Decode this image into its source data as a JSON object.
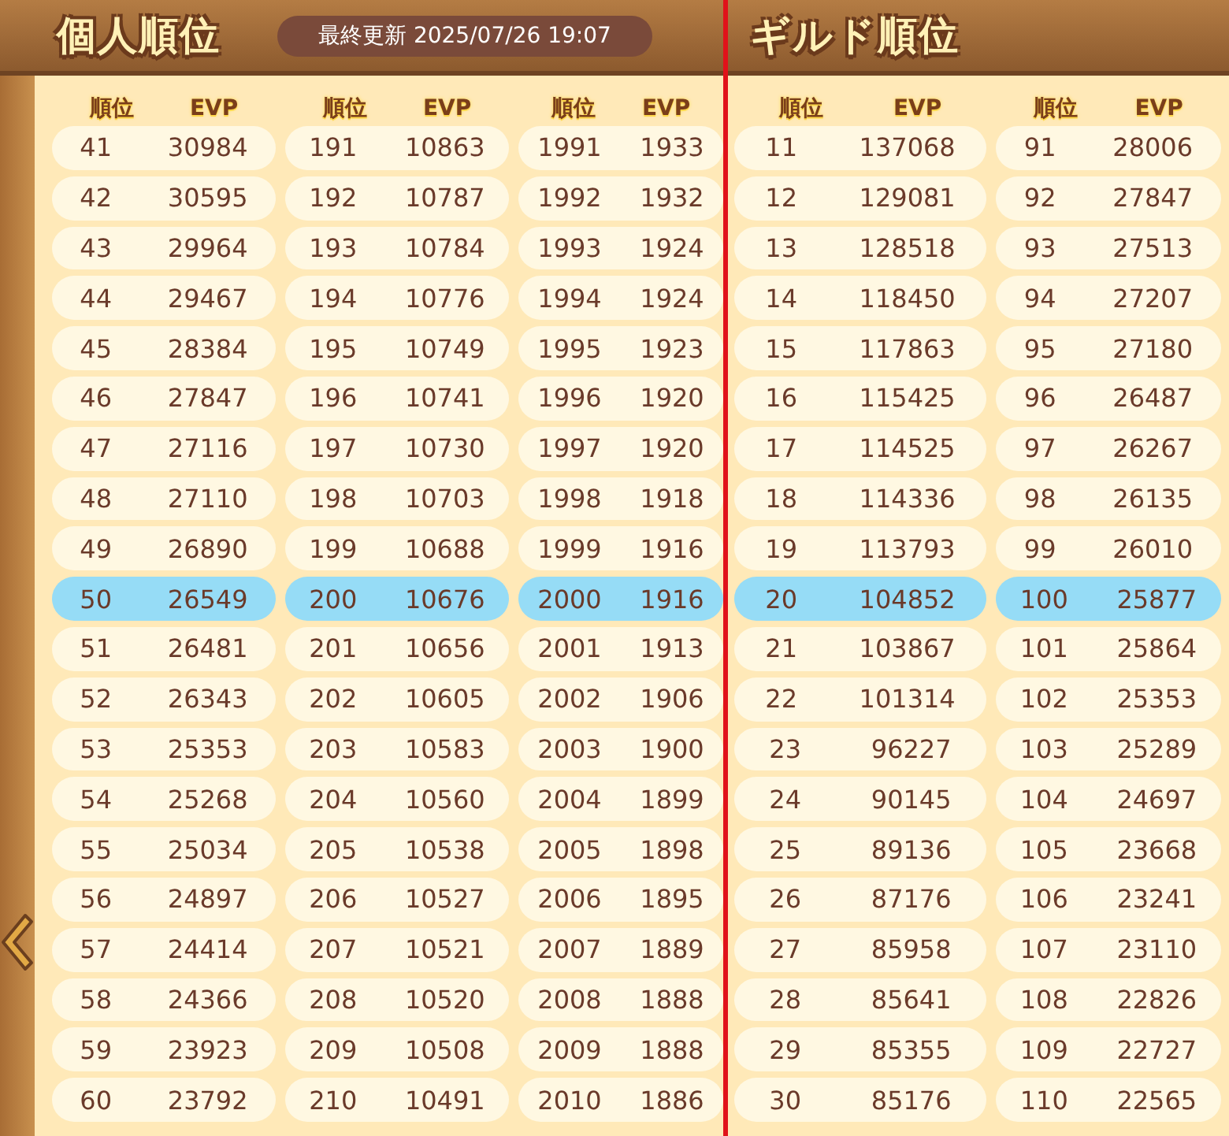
{
  "panels": [
    {
      "title": "個人順位",
      "updated": "最終更新 2025/07/26 19:07",
      "columns": [
        {
          "headers": [
            "順位",
            "EVP"
          ],
          "rows": [
            {
              "rank": "41",
              "evp": "30984",
              "selected": false
            },
            {
              "rank": "42",
              "evp": "30595",
              "selected": false
            },
            {
              "rank": "43",
              "evp": "29964",
              "selected": false
            },
            {
              "rank": "44",
              "evp": "29467",
              "selected": false
            },
            {
              "rank": "45",
              "evp": "28384",
              "selected": false
            },
            {
              "rank": "46",
              "evp": "27847",
              "selected": false
            },
            {
              "rank": "47",
              "evp": "27116",
              "selected": false
            },
            {
              "rank": "48",
              "evp": "27110",
              "selected": false
            },
            {
              "rank": "49",
              "evp": "26890",
              "selected": false
            },
            {
              "rank": "50",
              "evp": "26549",
              "selected": true
            },
            {
              "rank": "51",
              "evp": "26481",
              "selected": false
            },
            {
              "rank": "52",
              "evp": "26343",
              "selected": false
            },
            {
              "rank": "53",
              "evp": "25353",
              "selected": false
            },
            {
              "rank": "54",
              "evp": "25268",
              "selected": false
            },
            {
              "rank": "55",
              "evp": "25034",
              "selected": false
            },
            {
              "rank": "56",
              "evp": "24897",
              "selected": false
            },
            {
              "rank": "57",
              "evp": "24414",
              "selected": false
            },
            {
              "rank": "58",
              "evp": "24366",
              "selected": false
            },
            {
              "rank": "59",
              "evp": "23923",
              "selected": false
            },
            {
              "rank": "60",
              "evp": "23792",
              "selected": false
            }
          ]
        },
        {
          "headers": [
            "順位",
            "EVP"
          ],
          "rows": [
            {
              "rank": "191",
              "evp": "10863",
              "selected": false
            },
            {
              "rank": "192",
              "evp": "10787",
              "selected": false
            },
            {
              "rank": "193",
              "evp": "10784",
              "selected": false
            },
            {
              "rank": "194",
              "evp": "10776",
              "selected": false
            },
            {
              "rank": "195",
              "evp": "10749",
              "selected": false
            },
            {
              "rank": "196",
              "evp": "10741",
              "selected": false
            },
            {
              "rank": "197",
              "evp": "10730",
              "selected": false
            },
            {
              "rank": "198",
              "evp": "10703",
              "selected": false
            },
            {
              "rank": "199",
              "evp": "10688",
              "selected": false
            },
            {
              "rank": "200",
              "evp": "10676",
              "selected": true
            },
            {
              "rank": "201",
              "evp": "10656",
              "selected": false
            },
            {
              "rank": "202",
              "evp": "10605",
              "selected": false
            },
            {
              "rank": "203",
              "evp": "10583",
              "selected": false
            },
            {
              "rank": "204",
              "evp": "10560",
              "selected": false
            },
            {
              "rank": "205",
              "evp": "10538",
              "selected": false
            },
            {
              "rank": "206",
              "evp": "10527",
              "selected": false
            },
            {
              "rank": "207",
              "evp": "10521",
              "selected": false
            },
            {
              "rank": "208",
              "evp": "10520",
              "selected": false
            },
            {
              "rank": "209",
              "evp": "10508",
              "selected": false
            },
            {
              "rank": "210",
              "evp": "10491",
              "selected": false
            }
          ]
        },
        {
          "headers": [
            "順位",
            "EVP"
          ],
          "rows": [
            {
              "rank": "1991",
              "evp": "1933",
              "selected": false
            },
            {
              "rank": "1992",
              "evp": "1932",
              "selected": false
            },
            {
              "rank": "1993",
              "evp": "1924",
              "selected": false
            },
            {
              "rank": "1994",
              "evp": "1924",
              "selected": false
            },
            {
              "rank": "1995",
              "evp": "1923",
              "selected": false
            },
            {
              "rank": "1996",
              "evp": "1920",
              "selected": false
            },
            {
              "rank": "1997",
              "evp": "1920",
              "selected": false
            },
            {
              "rank": "1998",
              "evp": "1918",
              "selected": false
            },
            {
              "rank": "1999",
              "evp": "1916",
              "selected": false
            },
            {
              "rank": "2000",
              "evp": "1916",
              "selected": true
            },
            {
              "rank": "2001",
              "evp": "1913",
              "selected": false
            },
            {
              "rank": "2002",
              "evp": "1906",
              "selected": false
            },
            {
              "rank": "2003",
              "evp": "1900",
              "selected": false
            },
            {
              "rank": "2004",
              "evp": "1899",
              "selected": false
            },
            {
              "rank": "2005",
              "evp": "1898",
              "selected": false
            },
            {
              "rank": "2006",
              "evp": "1895",
              "selected": false
            },
            {
              "rank": "2007",
              "evp": "1889",
              "selected": false
            },
            {
              "rank": "2008",
              "evp": "1888",
              "selected": false
            },
            {
              "rank": "2009",
              "evp": "1888",
              "selected": false
            },
            {
              "rank": "2010",
              "evp": "1886",
              "selected": false
            }
          ]
        }
      ]
    },
    {
      "title": "ギルド順位",
      "columns": [
        {
          "headers": [
            "順位",
            "EVP"
          ],
          "rows": [
            {
              "rank": "11",
              "evp": "137068",
              "selected": false
            },
            {
              "rank": "12",
              "evp": "129081",
              "selected": false
            },
            {
              "rank": "13",
              "evp": "128518",
              "selected": false
            },
            {
              "rank": "14",
              "evp": "118450",
              "selected": false
            },
            {
              "rank": "15",
              "evp": "117863",
              "selected": false
            },
            {
              "rank": "16",
              "evp": "115425",
              "selected": false
            },
            {
              "rank": "17",
              "evp": "114525",
              "selected": false
            },
            {
              "rank": "18",
              "evp": "114336",
              "selected": false
            },
            {
              "rank": "19",
              "evp": "113793",
              "selected": false
            },
            {
              "rank": "20",
              "evp": "104852",
              "selected": true
            },
            {
              "rank": "21",
              "evp": "103867",
              "selected": false
            },
            {
              "rank": "22",
              "evp": "101314",
              "selected": false
            },
            {
              "rank": "23",
              "evp": "96227",
              "selected": false
            },
            {
              "rank": "24",
              "evp": "90145",
              "selected": false
            },
            {
              "rank": "25",
              "evp": "89136",
              "selected": false
            },
            {
              "rank": "26",
              "evp": "87176",
              "selected": false
            },
            {
              "rank": "27",
              "evp": "85958",
              "selected": false
            },
            {
              "rank": "28",
              "evp": "85641",
              "selected": false
            },
            {
              "rank": "29",
              "evp": "85355",
              "selected": false
            },
            {
              "rank": "30",
              "evp": "85176",
              "selected": false
            }
          ]
        },
        {
          "headers": [
            "順位",
            "EVP"
          ],
          "rows": [
            {
              "rank": "91",
              "evp": "28006",
              "selected": false
            },
            {
              "rank": "92",
              "evp": "27847",
              "selected": false
            },
            {
              "rank": "93",
              "evp": "27513",
              "selected": false
            },
            {
              "rank": "94",
              "evp": "27207",
              "selected": false
            },
            {
              "rank": "95",
              "evp": "27180",
              "selected": false
            },
            {
              "rank": "96",
              "evp": "26487",
              "selected": false
            },
            {
              "rank": "97",
              "evp": "26267",
              "selected": false
            },
            {
              "rank": "98",
              "evp": "26135",
              "selected": false
            },
            {
              "rank": "99",
              "evp": "26010",
              "selected": false
            },
            {
              "rank": "100",
              "evp": "25877",
              "selected": true
            },
            {
              "rank": "101",
              "evp": "25864",
              "selected": false
            },
            {
              "rank": "102",
              "evp": "25353",
              "selected": false
            },
            {
              "rank": "103",
              "evp": "25289",
              "selected": false
            },
            {
              "rank": "104",
              "evp": "24697",
              "selected": false
            },
            {
              "rank": "105",
              "evp": "23668",
              "selected": false
            },
            {
              "rank": "106",
              "evp": "23241",
              "selected": false
            },
            {
              "rank": "107",
              "evp": "23110",
              "selected": false
            },
            {
              "rank": "108",
              "evp": "22826",
              "selected": false
            },
            {
              "rank": "109",
              "evp": "22727",
              "selected": false
            },
            {
              "rank": "110",
              "evp": "22565",
              "selected": false
            }
          ]
        }
      ]
    }
  ]
}
